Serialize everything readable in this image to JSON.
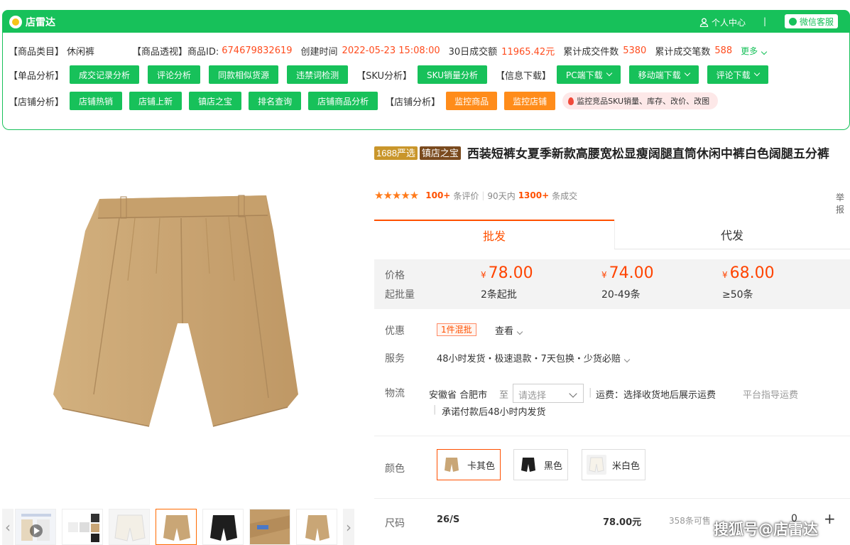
{
  "header": {
    "logo_text": "店雷达",
    "user_center": "个人中心",
    "separator": "|",
    "wechat_service": "微信客服"
  },
  "info_row": {
    "category_label": "【商品类目】",
    "category_value": "休闲裤",
    "perspective_label": "【商品透视】",
    "id_label": "商品ID:",
    "id_value": "674679832619",
    "created_label": "创建时间",
    "created_value": "2022-05-23 15:08:00",
    "sales30_label": "30日成交额",
    "sales30_value": "11965.42元",
    "cum_items_label": "累计成交件数",
    "cum_items_value": "5380",
    "cum_orders_label": "累计成交笔数",
    "cum_orders_value": "588",
    "more_label": "更多"
  },
  "single_row": {
    "label": "【单品分析】",
    "buttons": [
      "成交记录分析",
      "评论分析",
      "同款相似货源",
      "违禁词检测"
    ],
    "sku_label": "【SKU分析】",
    "sku_button": "SKU销量分析",
    "download_label": "【信息下载】",
    "download_buttons": [
      "PC端下载",
      "移动端下载",
      "评论下载"
    ]
  },
  "shop_row": {
    "label": "【店铺分析】",
    "buttons": [
      "店铺热销",
      "店铺上新",
      "镇店之宝",
      "排名查询",
      "店铺商品分析"
    ],
    "label2": "【店铺分析】",
    "orange_buttons": [
      "监控商品",
      "监控店铺"
    ],
    "pill_text": "监控竞品SKU销量、库存、改价、改图"
  },
  "product": {
    "tag1": "1688严选",
    "tag2": "镇店之宝",
    "title": "西装短裤女夏季新款高腰宽松显瘦阔腿直筒休闲中裤白色阔腿五分裤",
    "reviews_count": "100+",
    "reviews_label": "条评价",
    "days_label": "90天内",
    "deals_count": "1300+",
    "deals_label": "条成交",
    "report": "举报"
  },
  "tabs": {
    "wholesale": "批发",
    "dropship": "代发"
  },
  "price": {
    "price_label": "价格",
    "moq_label": "起批量",
    "currency": "¥",
    "tiers": [
      {
        "price": "78.00",
        "qty": "2条起批"
      },
      {
        "price": "74.00",
        "qty": "20-49条"
      },
      {
        "price": "68.00",
        "qty": "≥50条"
      }
    ]
  },
  "details": {
    "discount_label": "优惠",
    "discount_tag": "1件混批",
    "discount_view": "查看",
    "service_label": "服务",
    "service_value": "48小时发货・极速退款・7天包换・少货必赔",
    "logistics_label": "物流",
    "origin": "安徽省 合肥市",
    "to_label": "至",
    "select_placeholder": "请选择",
    "freight": "运费：选择收货地后展示运费",
    "platform_freight": "平台指导运费",
    "ship_promise": "承诺付款后48小时内发货"
  },
  "colors": {
    "label": "颜色",
    "options": [
      "卡其色",
      "黑色",
      "米白色"
    ]
  },
  "size_row": {
    "label": "尺码",
    "size": "26/S",
    "price": "78.00元",
    "stock": "358条可售",
    "qty": "0",
    "plus": "+"
  },
  "watermark": "搜狐号@店雷达",
  "palette": {
    "green": "#17c15a",
    "orange": "#ff8c1a",
    "price_red": "#ff4400",
    "khaki": "#c9a676"
  }
}
